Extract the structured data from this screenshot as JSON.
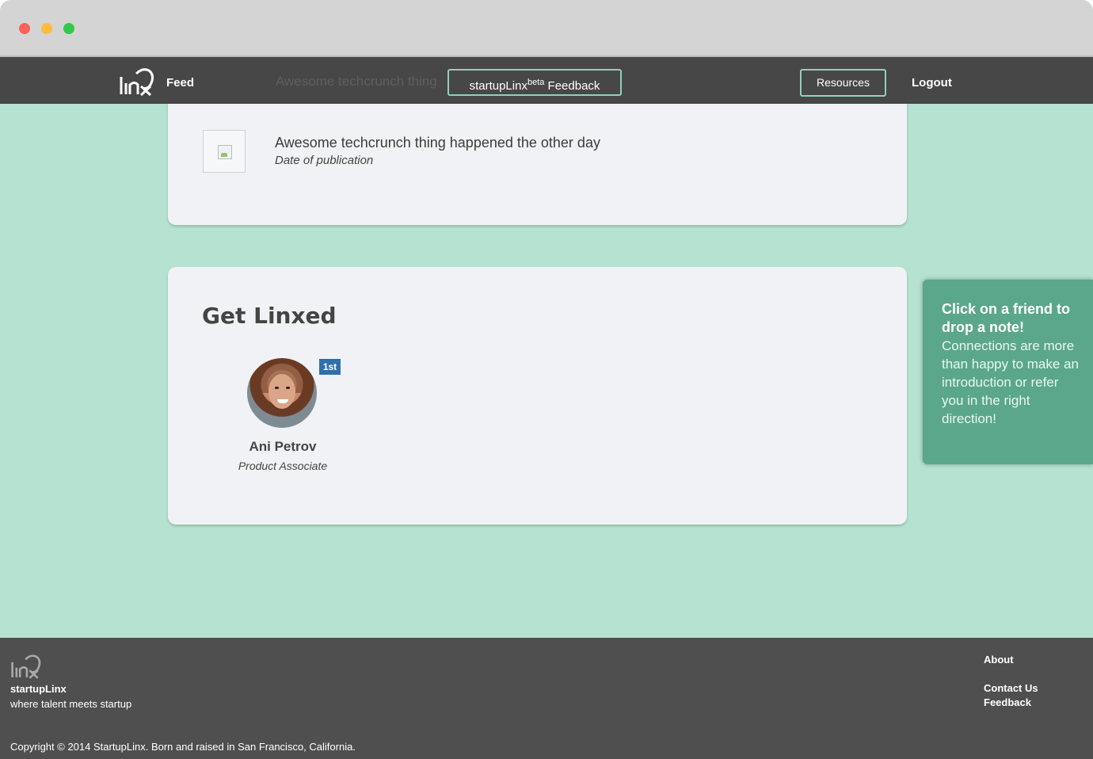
{
  "nav": {
    "feed_label": "Feed",
    "feedback_prefix": "startupLinx",
    "feedback_sup": "beta",
    "feedback_suffix": " Feedback",
    "resources_label": "Resources",
    "logout_label": "Logout",
    "ghost_text": "Awesome techcrunch thing"
  },
  "news": {
    "items": [
      {
        "title": "Awesome techcrunch thing happened the other day",
        "date": "Date of publication"
      }
    ]
  },
  "linx": {
    "title": "Get Linxed",
    "friend": {
      "name": "Ani Petrov",
      "role": "Product Associate",
      "badge": "1st"
    }
  },
  "tip": {
    "bold": "Click on a friend to drop a note!",
    "text": "Connections are more than happy to make an introduction or refer you in the right direction!"
  },
  "footer": {
    "brand": "startupLinx",
    "tagline": "where talent meets startup",
    "about": "About",
    "contact": "Contact Us",
    "feedback": "Feedback",
    "copyright": "Copyright © 2014 StartupLinx. Born and raised in San Francisco, California."
  },
  "colors": {
    "background": "#b5e2d1",
    "navbar": "#474747",
    "footer": "#4f4f4f",
    "accent_border": "#8fd1bb",
    "tip": "#5aa78c",
    "badge": "#2e6fae"
  }
}
